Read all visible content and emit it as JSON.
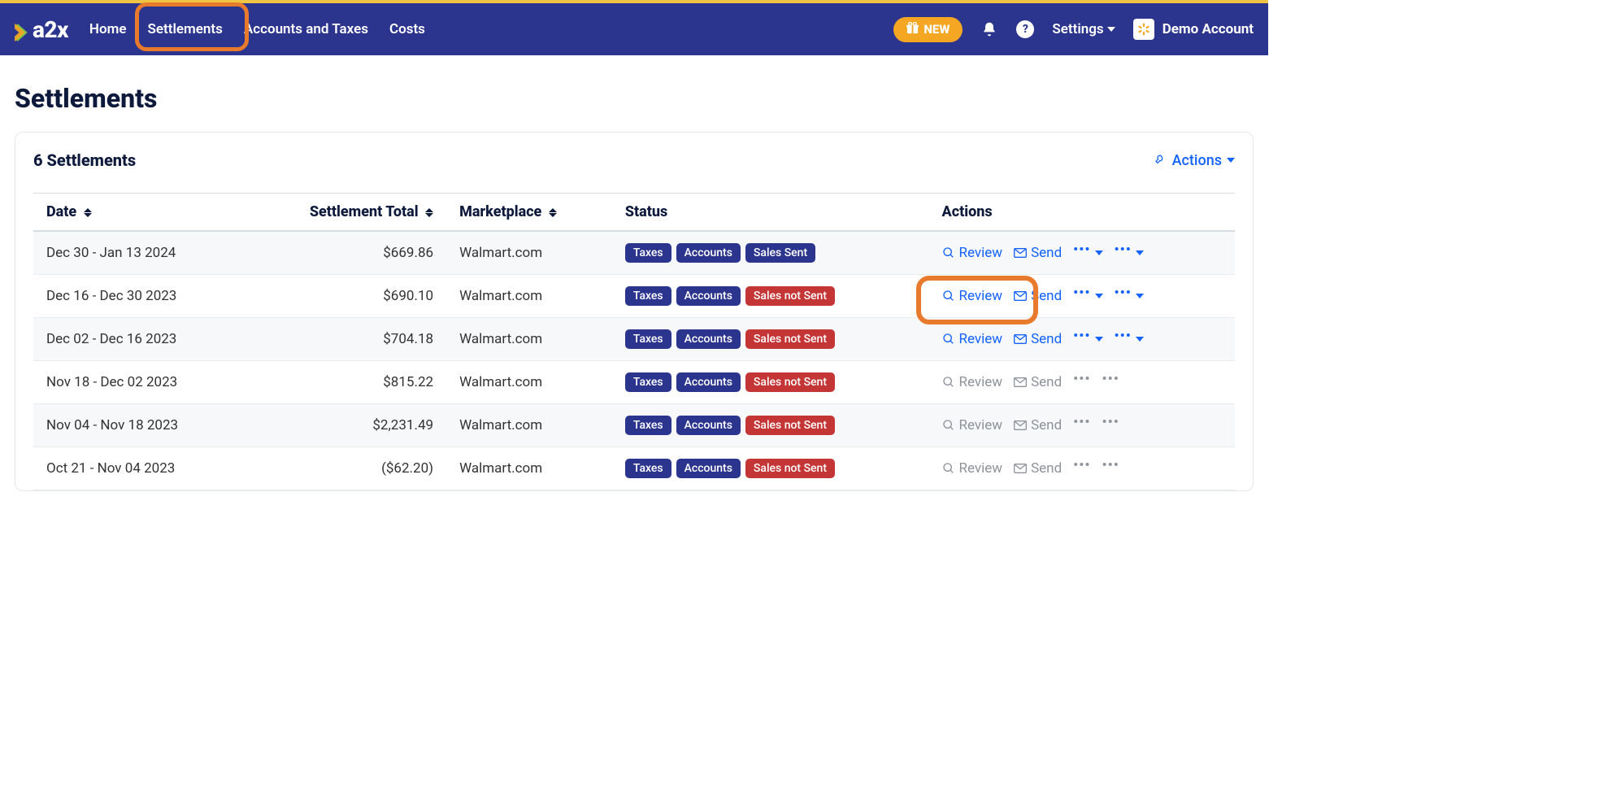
{
  "brand": "a2x",
  "nav": {
    "home": "Home",
    "settlements": "Settlements",
    "accounts": "Accounts and Taxes",
    "costs": "Costs"
  },
  "new_badge": "NEW",
  "settings": "Settings",
  "account": "Demo Account",
  "page_title": "Settlements",
  "card_title": "6 Settlements",
  "actions_label": "Actions",
  "columns": {
    "date": "Date",
    "total": "Settlement Total",
    "marketplace": "Marketplace",
    "status": "Status",
    "actions": "Actions"
  },
  "action_labels": {
    "review": "Review",
    "send": "Send"
  },
  "rows": [
    {
      "date": "Dec 30 - Jan 13 2024",
      "total": "$669.86",
      "marketplace": "Walmart.com",
      "status": [
        "Taxes",
        "Accounts",
        "Sales Sent"
      ],
      "sent": true,
      "enabled": true,
      "highlight": false
    },
    {
      "date": "Dec 16 - Dec 30 2023",
      "total": "$690.10",
      "marketplace": "Walmart.com",
      "status": [
        "Taxes",
        "Accounts",
        "Sales not Sent"
      ],
      "sent": false,
      "enabled": true,
      "highlight": true
    },
    {
      "date": "Dec 02 - Dec 16 2023",
      "total": "$704.18",
      "marketplace": "Walmart.com",
      "status": [
        "Taxes",
        "Accounts",
        "Sales not Sent"
      ],
      "sent": false,
      "enabled": true,
      "highlight": false
    },
    {
      "date": "Nov 18 - Dec 02 2023",
      "total": "$815.22",
      "marketplace": "Walmart.com",
      "status": [
        "Taxes",
        "Accounts",
        "Sales not Sent"
      ],
      "sent": false,
      "enabled": false,
      "highlight": false
    },
    {
      "date": "Nov 04 - Nov 18 2023",
      "total": "$2,231.49",
      "marketplace": "Walmart.com",
      "status": [
        "Taxes",
        "Accounts",
        "Sales not Sent"
      ],
      "sent": false,
      "enabled": false,
      "highlight": false
    },
    {
      "date": "Oct 21 - Nov 04 2023",
      "total": "($62.20)",
      "marketplace": "Walmart.com",
      "status": [
        "Taxes",
        "Accounts",
        "Sales not Sent"
      ],
      "sent": false,
      "enabled": false,
      "highlight": false
    }
  ]
}
